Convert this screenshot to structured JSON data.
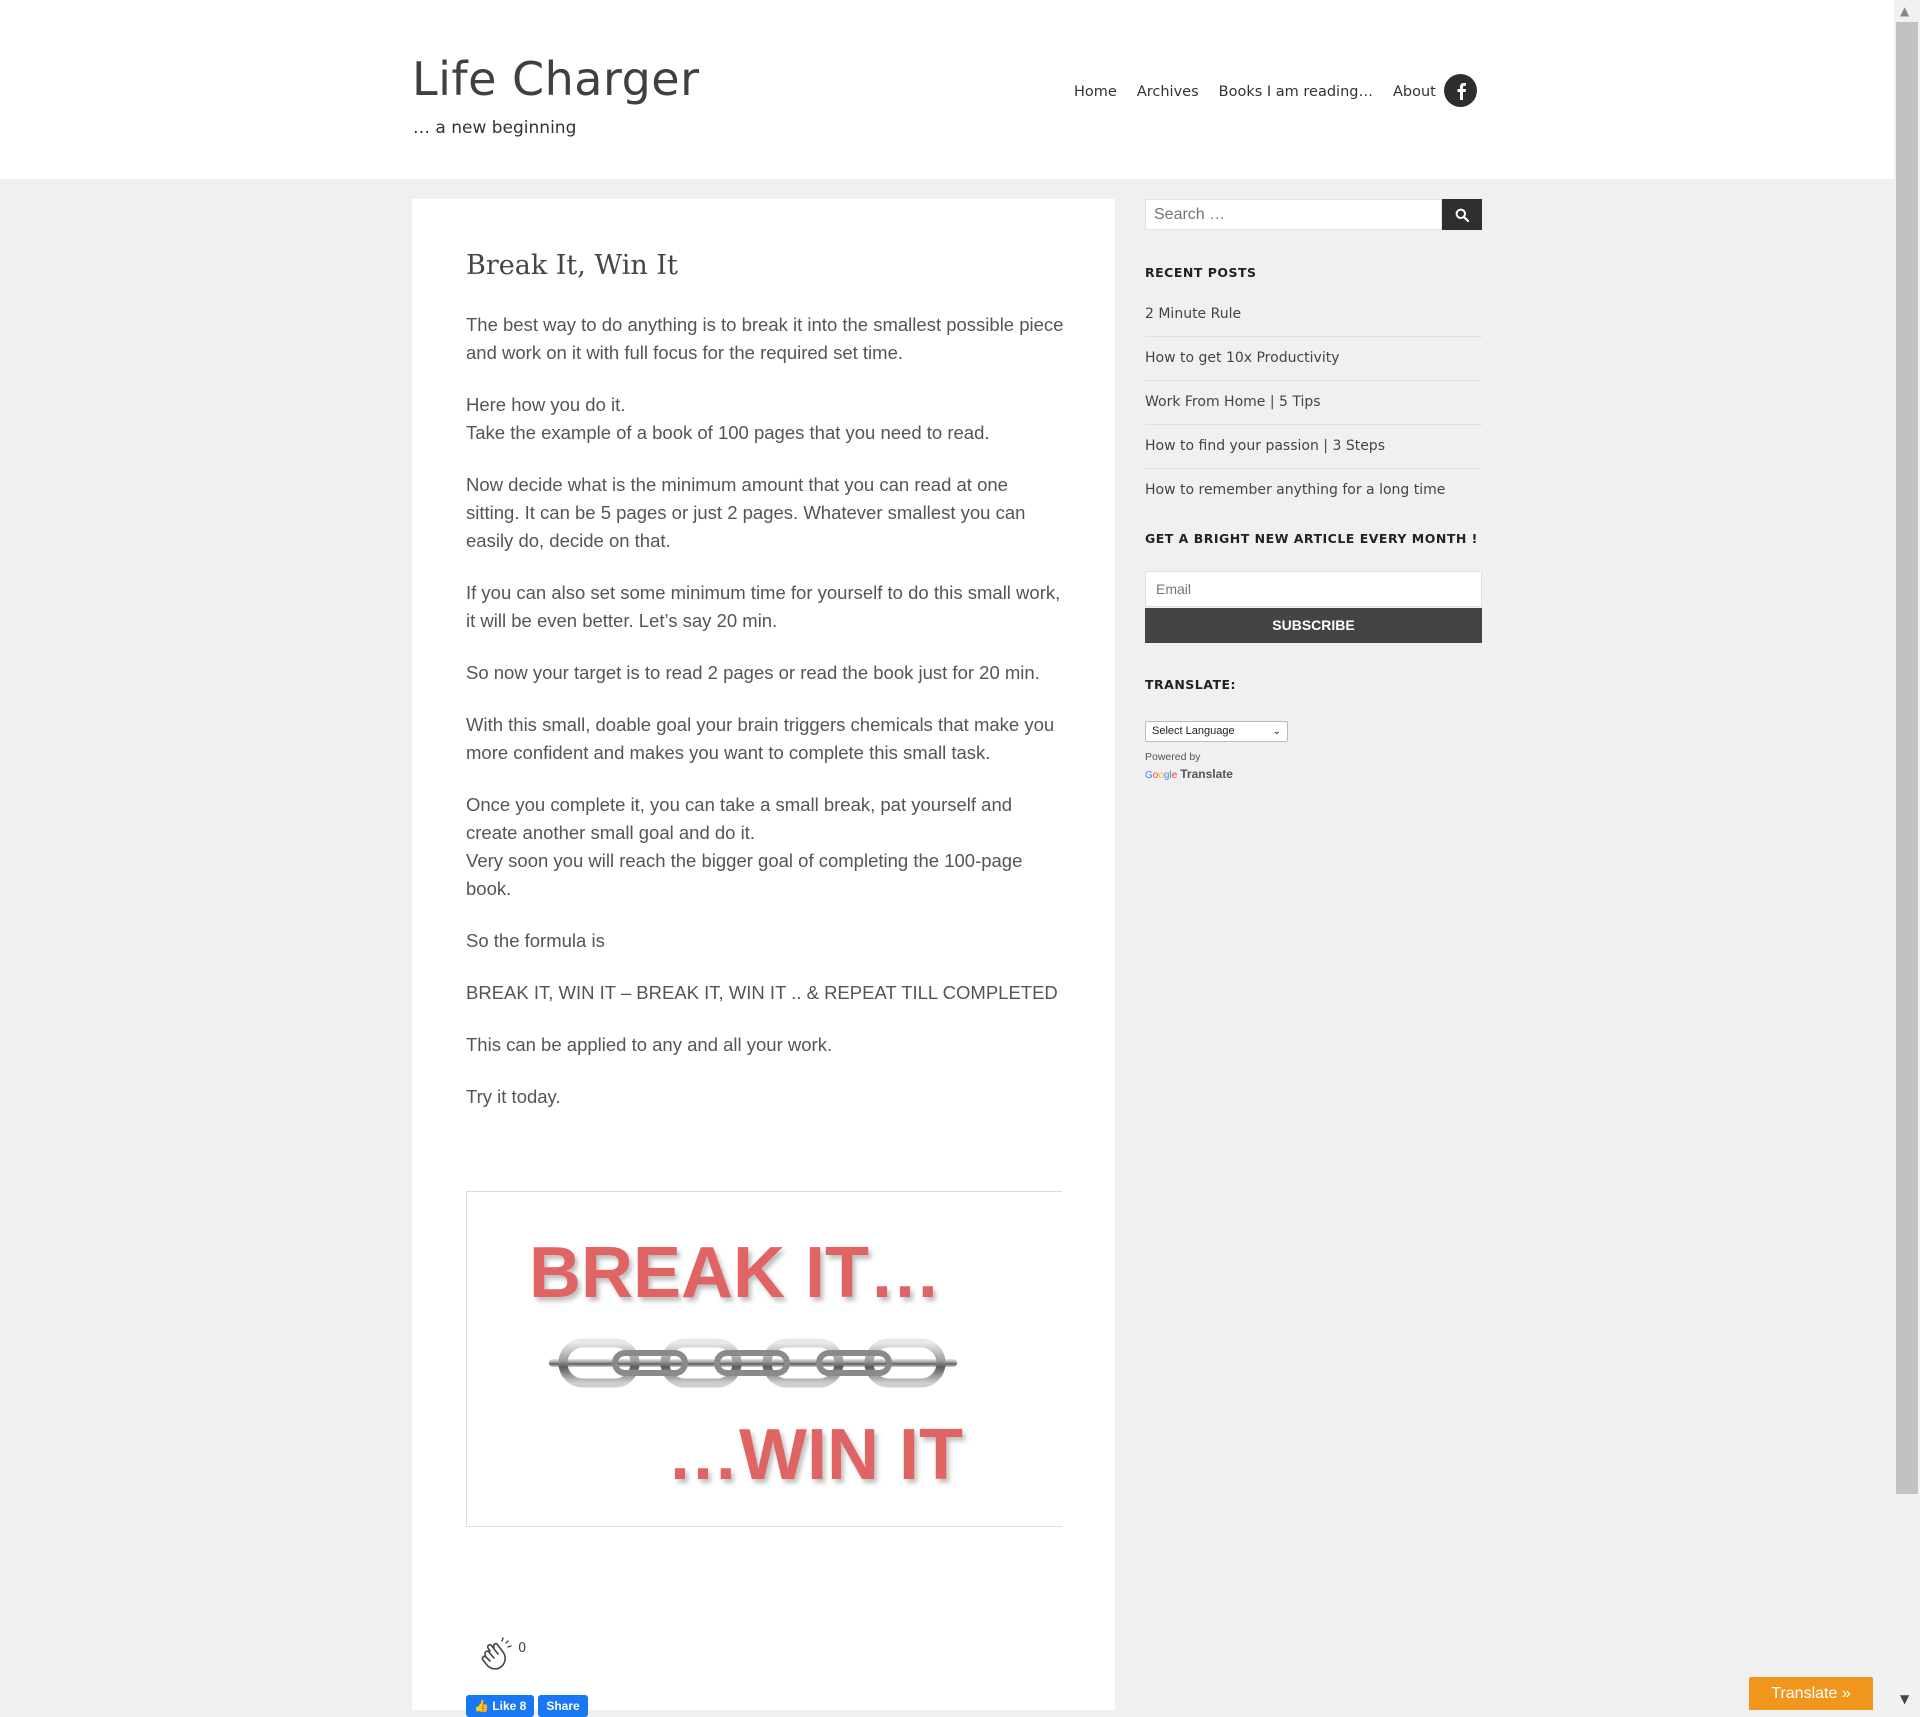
{
  "site": {
    "title": "Life Charger",
    "tagline": "… a new beginning"
  },
  "nav": {
    "items": [
      "Home",
      "Archives",
      "Books I am reading…",
      "About"
    ]
  },
  "post": {
    "title": "Break It, Win It",
    "paragraphs": [
      "The best way to do anything is to break it into the smallest possible piece and work on it with full focus for the required set time.",
      "Here how you do it.\nTake the example of a book of 100 pages that you need to read.",
      "Now decide what is the minimum amount that you can read at one sitting. It can be 5 pages or just 2 pages. Whatever smallest you can easily do, decide on that.",
      "If you can also set some minimum time for yourself to do this small work, it will be even better. Let’s say 20 min.",
      "So now your target is to read 2 pages or read the book just for 20 min.",
      "With this small, doable goal your brain triggers chemicals that make you more confident and makes you want to complete this small task.",
      "Once you complete it, you can take a small break, pat yourself and create another small goal and do it.\nVery soon you will reach the bigger goal of completing the 100-page book.",
      "So the formula is",
      "BREAK IT, WIN IT – BREAK IT, WIN IT .. & REPEAT TILL COMPLETED",
      "This can be applied to any and all your work.",
      "Try it today."
    ],
    "image": {
      "top_text": "BREAK IT…",
      "bottom_text": "…WIN IT"
    },
    "claps": "0",
    "fb_like": "Like 8",
    "fb_share": "Share"
  },
  "sidebar": {
    "search_placeholder": "Search …",
    "recent_title": "RECENT POSTS",
    "recent_posts": [
      "2 Minute Rule",
      "How to get 10x Productivity",
      "Work From Home | 5 Tips",
      "How to find your passion | 3 Steps",
      "How to remember anything for a long time"
    ],
    "newsletter_title": "GET A BRIGHT NEW ARTICLE EVERY MONTH !",
    "email_placeholder": "Email",
    "subscribe_label": "SUBSCRIBE",
    "translate_title": "TRANSLATE:",
    "language_select": "Select Language",
    "powered_by": "Powered by",
    "google": "Google",
    "translate": "Translate"
  },
  "floating": {
    "translate_button": "Translate »"
  },
  "colors": {
    "accent_red": "#e06464",
    "dark": "#444444",
    "translate_orange": "#f0961c",
    "facebook_blue": "#1877f2"
  }
}
